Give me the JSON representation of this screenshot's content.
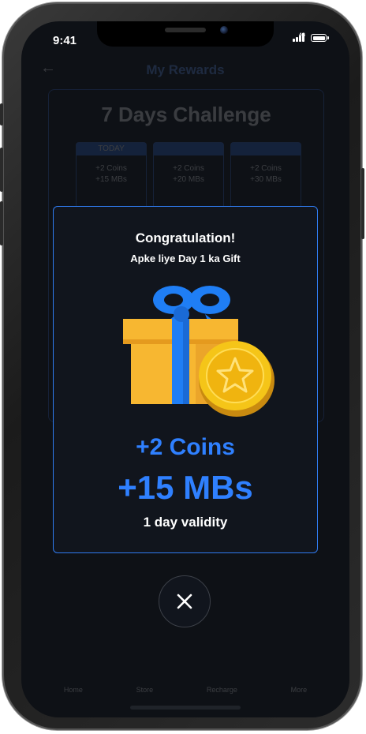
{
  "status_bar": {
    "time": "9:41",
    "network": "4G"
  },
  "background_app": {
    "header_title": "My Rewards",
    "challenge_title": "7 Days Challenge",
    "days": [
      {
        "head": "TODAY",
        "line1": "+2 Coins",
        "line2": "+15 MBs"
      },
      {
        "head": "",
        "line1": "+2 Coins",
        "line2": "+20 MBs"
      },
      {
        "head": "",
        "line1": "+2 Coins",
        "line2": "+30 MBs"
      }
    ],
    "nav": [
      "Home",
      "Store",
      "Recharge",
      "More"
    ]
  },
  "modal": {
    "title": "Congratulation!",
    "subtitle": "Apke liye Day 1 ka Gift",
    "coins": "+2 Coins",
    "data": "+15 MBs",
    "validity": "1 day validity"
  },
  "colors": {
    "accent": "#2f80ff",
    "screen_bg": "#0e1116",
    "modal_border": "#2f7bf0",
    "gift_box": "#f7b731",
    "coin": "#f5c518"
  },
  "icons": {
    "close": "close-icon",
    "gift": "gift-box-icon",
    "coin": "star-coin-icon"
  }
}
